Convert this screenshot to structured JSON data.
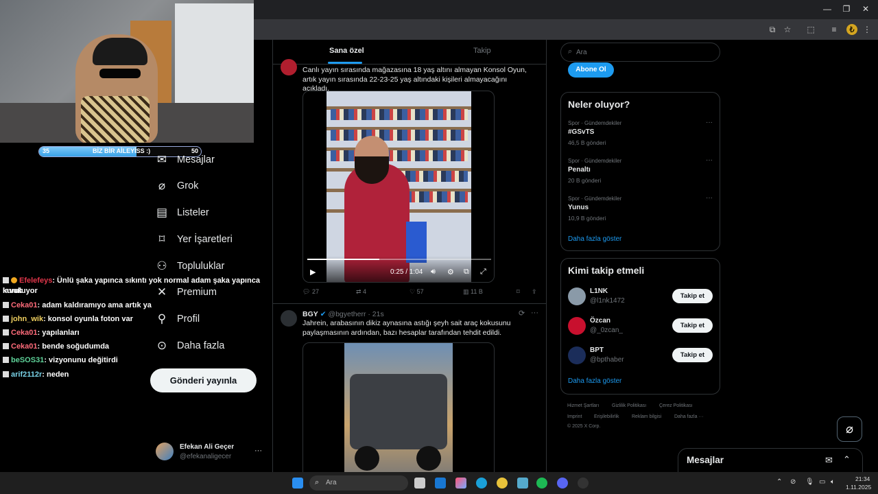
{
  "stream": {
    "progress": {
      "min_label": "35",
      "max_label": "50",
      "label": "BİZ BİR AİLEYİSS :)",
      "fraction": 0.6
    },
    "chat": [
      {
        "user": "Efelefeys",
        "color": "#e0364a",
        "msg": ": Ünlü şaka yapınca sıkıntı yok normal adam şaka yapınca kuruluyor",
        "cont": "lavuk"
      },
      {
        "user": "Ceka01",
        "color": "#ff6b7a",
        "msg": ": adam kaldıramıyo ama artık ya"
      },
      {
        "user": "john_wik",
        "color": "#f0d060",
        "msg": ": konsol oyunla foton var"
      },
      {
        "user": "Ceka01",
        "color": "#ff6b7a",
        "msg": ": yapılanları"
      },
      {
        "user": "Ceka01",
        "color": "#ff6b7a",
        "msg": ": bende soğudumda"
      },
      {
        "user": "beSOS31",
        "color": "#5fd39a",
        "msg": ": vizyonunu değitirdi"
      },
      {
        "user": "arif2112r",
        "color": "#7ad3e8",
        "msg": ": neden"
      }
    ]
  },
  "nav": {
    "items": [
      {
        "label": "Mesajlar",
        "icon": "mail-icon"
      },
      {
        "label": "Grok",
        "icon": "grok-icon"
      },
      {
        "label": "Listeler",
        "icon": "list-icon"
      },
      {
        "label": "Yer İşaretleri",
        "icon": "bookmark-icon"
      },
      {
        "label": "Topluluklar",
        "icon": "communities-icon"
      },
      {
        "label": "Premium",
        "icon": "x-logo-icon"
      },
      {
        "label": "Profil",
        "icon": "person-icon"
      },
      {
        "label": "Daha fazla",
        "icon": "more-circle-icon"
      }
    ],
    "post_button": "Gönderi yayınla",
    "account": {
      "name": "Efekan Ali Geçer",
      "handle": "@efekanaligecer",
      "more": "···"
    }
  },
  "feed": {
    "tabs": [
      "Sana özel",
      "Takip"
    ],
    "tweet1": {
      "text": "Canlı yayın sırasında mağazasına 18 yaş altını almayan Konsol Oyun, artık yayın sırasında 22-23-25 yaş altındaki kişileri almayacağını açıkladı.",
      "video_time": "0:25 / 1:04",
      "replies": "27",
      "reposts": "4",
      "likes": "57",
      "views": "11 B"
    },
    "tweet2": {
      "name": "BGY",
      "handle": "@bgyetherr",
      "time": "· 21s",
      "text": "Jahrein, arabasının dikiz aynasına astığı şeyh sait araç kokusunu paylaşmasının ardından, bazı hesaplar tarafından tehdit edildi.",
      "more": "···"
    }
  },
  "right": {
    "search_placeholder": "Ara",
    "subscribe_button": "Abone Ol",
    "trends_title": "Neler oluyor?",
    "trends": [
      {
        "meta": "Spor · Gündemdekiler",
        "name": "#GSvTS",
        "count": "46,5 B gönderi"
      },
      {
        "meta": "Spor · Gündemdekiler",
        "name": "Penaltı",
        "count": "20 B gönderi"
      },
      {
        "meta": "Spor · Gündemdekiler",
        "name": "Yunus",
        "count": "10,9 B gönderi"
      }
    ],
    "show_more": "Daha fazla göster",
    "who_title": "Kimi takip etmeli",
    "who": [
      {
        "name": "L1NK",
        "handle": "@l1nk1472",
        "button": "Takip et"
      },
      {
        "name": "Özcan",
        "handle": "@_0zcan_",
        "button": "Takip et"
      },
      {
        "name": "BPT",
        "handle": "@bpthaber",
        "button": "Takip et"
      }
    ],
    "footer": {
      "l1": [
        "Hizmet Şartları",
        "Gizlilik Politikası",
        "Çerez Politikası"
      ],
      "l2": [
        "Imprint",
        "Erişilebilirlik",
        "Reklam bilgisi",
        "Daha fazla ···"
      ],
      "copyright": "© 2025 X Corp."
    },
    "messages_title": "Mesajlar"
  },
  "taskbar": {
    "search_placeholder": "Ara",
    "time": "21:34",
    "date": "1.11.2025"
  },
  "colors": {
    "accent": "#1d9bf0",
    "bg": "#000000",
    "border": "#2f3336"
  }
}
